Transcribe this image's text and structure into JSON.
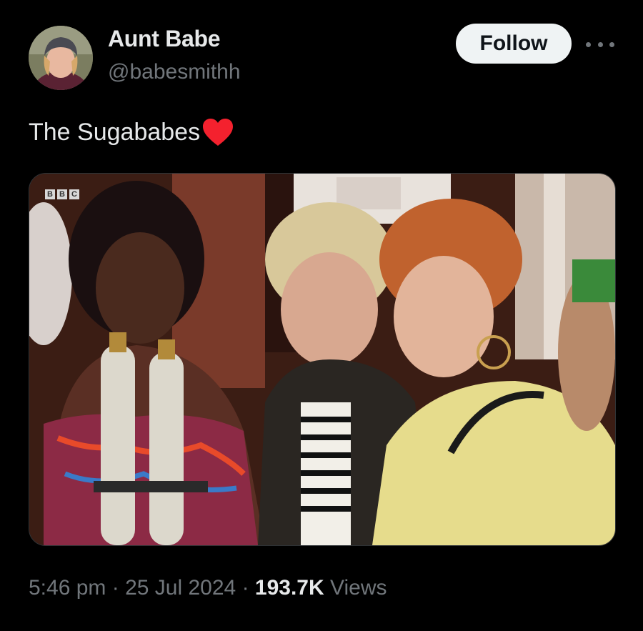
{
  "tweet": {
    "author": {
      "display_name": "Aunt Babe",
      "handle": "@babesmithh"
    },
    "follow_label": "Follow",
    "text": "The Sugababes",
    "emoji": "red-heart",
    "media": {
      "watermark": [
        "B",
        "B",
        "C"
      ]
    },
    "time": "5:46 pm",
    "separator": "·",
    "date": "25 Jul 2024",
    "views_count": "193.7K",
    "views_label": "Views"
  },
  "colors": {
    "background": "#000000",
    "primary_text": "#e7e9ea",
    "secondary_text": "#71767b",
    "follow_button_bg": "#eff3f4",
    "heart": "#f4212e"
  }
}
